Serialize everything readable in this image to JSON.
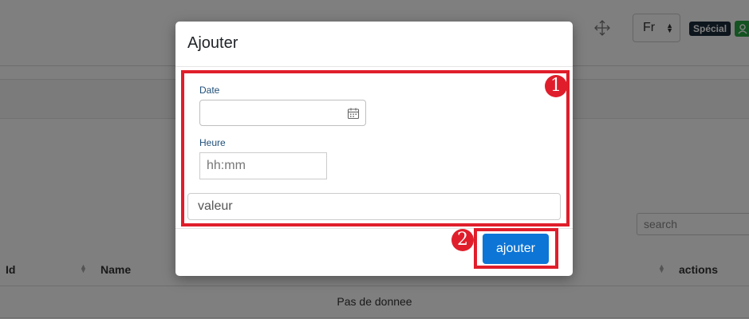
{
  "header": {
    "language_value": "Fr",
    "special_badge": "Spécial",
    "move_icon": "move-icon",
    "user_icon": "user-icon"
  },
  "search": {
    "placeholder": "search"
  },
  "table": {
    "columns": [
      "Id",
      "Name",
      "actions"
    ],
    "empty_message": "Pas de donnee"
  },
  "modal": {
    "title": "Ajouter",
    "date_label": "Date",
    "time_label": "Heure",
    "time_placeholder": "hh:mm",
    "value_placeholder": "valeur",
    "submit_label": "ajouter"
  },
  "callouts": [
    "1",
    "2"
  ],
  "colors": {
    "callout": "#e01e2b",
    "primary_button": "#0c75d6",
    "badge_dark": "#1a2a3a",
    "badge_green": "#28a745"
  }
}
